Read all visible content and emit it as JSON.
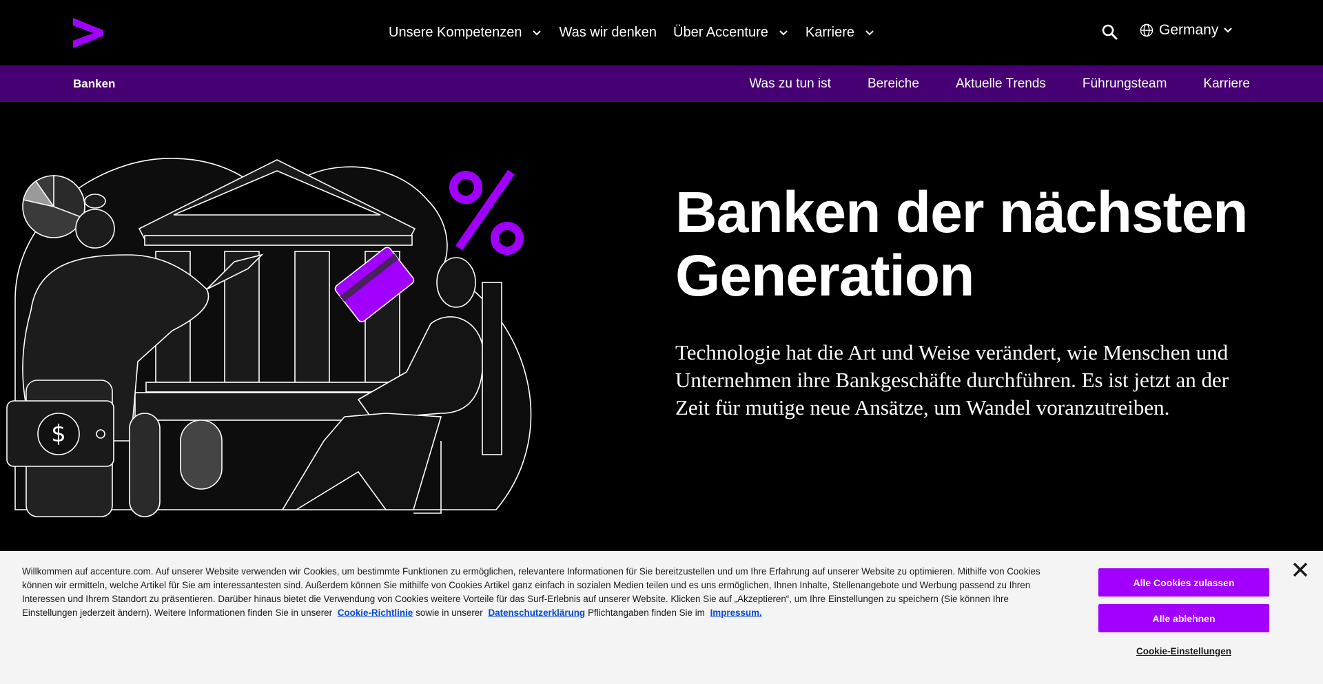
{
  "header": {
    "logo_icon": "accenture-chevron-logo",
    "nav": [
      {
        "label": "Unsere Kompetenzen",
        "has_dropdown": true
      },
      {
        "label": "Was wir denken",
        "has_dropdown": false
      },
      {
        "label": "Über Accenture",
        "has_dropdown": true
      },
      {
        "label": "Karriere",
        "has_dropdown": true
      }
    ],
    "search_icon": "search-icon",
    "country": "Germany"
  },
  "subnav": {
    "title": "Banken",
    "links": [
      "Was zu tun ist",
      "Bereiche",
      "Aktuelle Trends",
      "Führungsteam",
      "Karriere"
    ]
  },
  "hero": {
    "title_line1": "Banken der nächsten",
    "title_line2": "Generation",
    "text": "Technologie hat die Art und Weise verändert, wie Menschen und Unternehmen ihre Bankgeschäfte durchführen. Es ist jetzt an der Zeit für mutige neue Ansätze, um Wandel voranzutreiben."
  },
  "cookie_banner": {
    "text_main": "Willkommen auf accenture.com. Auf unserer Website verwenden wir Cookies, um bestimmte Funktionen zu ermöglichen, relevantere Informationen für Sie bereitzustellen und um Ihre Erfahrung auf unserer Website zu optimieren. Mithilfe von Cookies können wir ermitteln, welche Artikel für Sie am interessantesten sind. Außerdem können Sie mithilfe von Cookies Artikel ganz einfach in sozialen Medien teilen und es uns ermöglichen, Ihnen Inhalte, Stellenangebote und Werbung passend zu Ihren Interessen und Ihrem Standort zu präsentieren. Darüber hinaus bietet die Verwendung von Cookies weitere Vorteile für das Surf-Erlebnis auf unserer Website. Klicken Sie auf „Akzeptieren“, um Ihre Einstellungen zu speichern (Sie können Ihre Einstellungen jederzeit ändern). Weitere Informationen finden Sie in unserer",
    "link_cookie_policy": "Cookie-Richtlinie",
    "text_mid": "sowie in unserer",
    "link_privacy": "Datenschutzerklärung",
    "text_tail": "Pflichtangaben finden Sie im",
    "link_imprint": "Impressum.",
    "accept_all": "Alle Cookies zulassen",
    "reject_all": "Alle ablehnen",
    "settings": "Cookie-Einstellungen"
  },
  "colors": {
    "accent_purple": "#a100ff",
    "subnav_bg": "#460073",
    "background": "#000000",
    "cookie_bg": "#f4f4f4"
  }
}
